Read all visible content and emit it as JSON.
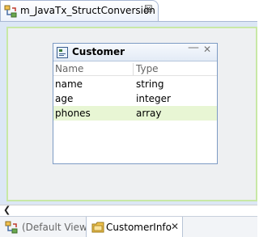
{
  "editor_tab": {
    "title": "m_JavaTx_StructConversion",
    "close": "☒"
  },
  "widget": {
    "title": "Customer",
    "minimize": "—",
    "close": "✕",
    "columns": {
      "name": "Name",
      "type": "Type"
    },
    "rows": [
      {
        "name": "name",
        "type": "string"
      },
      {
        "name": "age",
        "type": "integer"
      },
      {
        "name": "phones",
        "type": "array"
      }
    ]
  },
  "scrollbar": {
    "left_arrow": "❮"
  },
  "bottom_tabs": {
    "default_view": "(Default View)",
    "active": "CustomerInfo",
    "active_close": "✕"
  }
}
